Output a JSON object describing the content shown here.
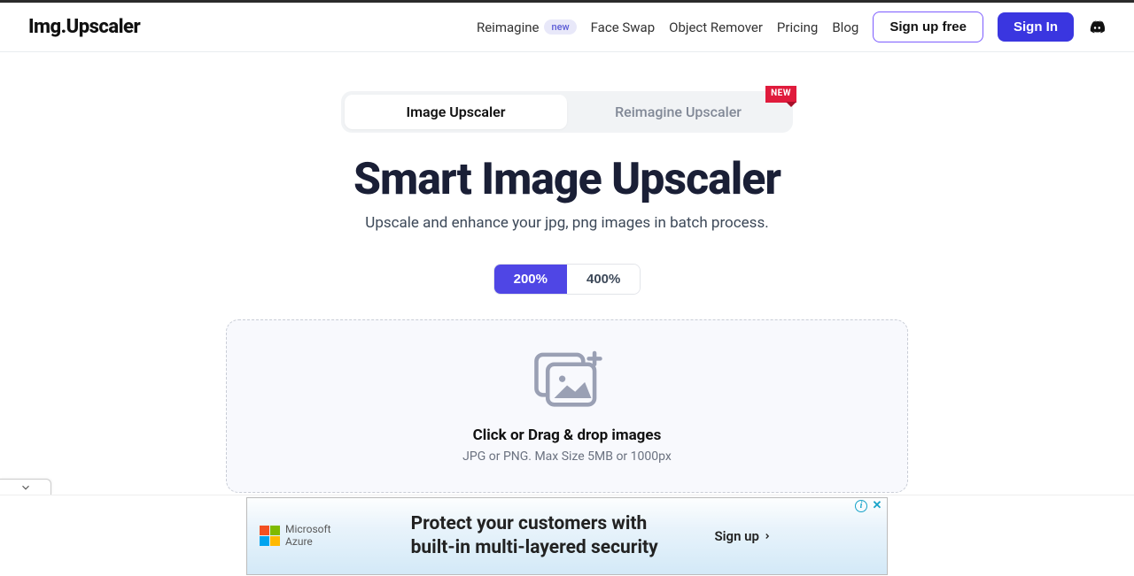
{
  "header": {
    "logo": "Img.Upscaler",
    "nav": {
      "reimagine": "Reimagine",
      "reimagine_badge": "new",
      "face_swap": "Face Swap",
      "object_remover": "Object Remover",
      "pricing": "Pricing",
      "blog": "Blog"
    },
    "signup": "Sign up free",
    "signin": "Sign In"
  },
  "tabs": {
    "image_upscaler": "Image Upscaler",
    "reimagine_upscaler": "Reimagine Upscaler",
    "new_flag": "NEW"
  },
  "hero": {
    "title": "Smart Image Upscaler",
    "subtitle": "Upscale and enhance your jpg, png images in batch process."
  },
  "scale": {
    "opt_200": "200%",
    "opt_400": "400%"
  },
  "dropzone": {
    "title": "Click or Drag & drop images",
    "sub": "JPG or PNG. Max Size 5MB or 1000px"
  },
  "ad": {
    "brand_line1": "Microsoft",
    "brand_line2": "Azure",
    "copy_line1": "Protect your customers with",
    "copy_line2": "built-in multi-layered security",
    "cta": "Sign up"
  }
}
